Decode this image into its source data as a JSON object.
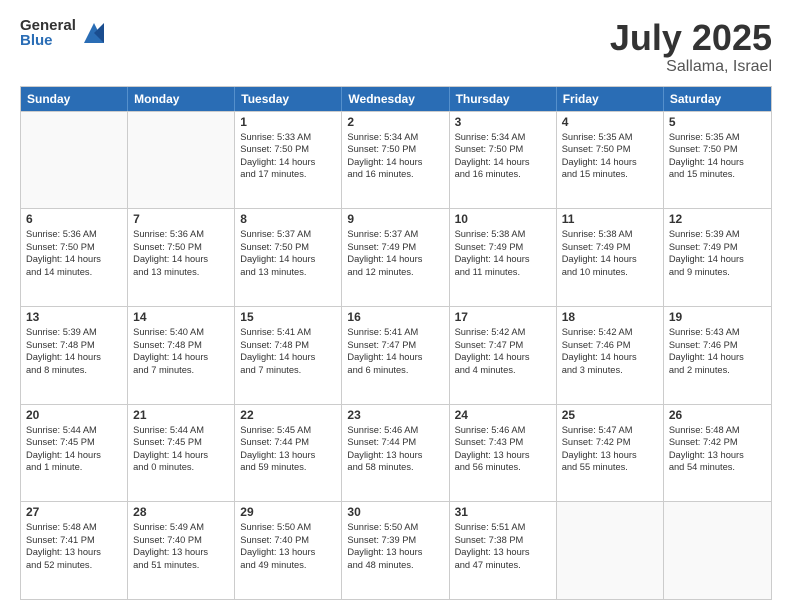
{
  "header": {
    "logo_general": "General",
    "logo_blue": "Blue",
    "title": "July 2025",
    "subtitle": "Sallama, Israel"
  },
  "days": [
    "Sunday",
    "Monday",
    "Tuesday",
    "Wednesday",
    "Thursday",
    "Friday",
    "Saturday"
  ],
  "rows": [
    [
      {
        "day": "",
        "lines": []
      },
      {
        "day": "",
        "lines": []
      },
      {
        "day": "1",
        "lines": [
          "Sunrise: 5:33 AM",
          "Sunset: 7:50 PM",
          "Daylight: 14 hours",
          "and 17 minutes."
        ]
      },
      {
        "day": "2",
        "lines": [
          "Sunrise: 5:34 AM",
          "Sunset: 7:50 PM",
          "Daylight: 14 hours",
          "and 16 minutes."
        ]
      },
      {
        "day": "3",
        "lines": [
          "Sunrise: 5:34 AM",
          "Sunset: 7:50 PM",
          "Daylight: 14 hours",
          "and 16 minutes."
        ]
      },
      {
        "day": "4",
        "lines": [
          "Sunrise: 5:35 AM",
          "Sunset: 7:50 PM",
          "Daylight: 14 hours",
          "and 15 minutes."
        ]
      },
      {
        "day": "5",
        "lines": [
          "Sunrise: 5:35 AM",
          "Sunset: 7:50 PM",
          "Daylight: 14 hours",
          "and 15 minutes."
        ]
      }
    ],
    [
      {
        "day": "6",
        "lines": [
          "Sunrise: 5:36 AM",
          "Sunset: 7:50 PM",
          "Daylight: 14 hours",
          "and 14 minutes."
        ]
      },
      {
        "day": "7",
        "lines": [
          "Sunrise: 5:36 AM",
          "Sunset: 7:50 PM",
          "Daylight: 14 hours",
          "and 13 minutes."
        ]
      },
      {
        "day": "8",
        "lines": [
          "Sunrise: 5:37 AM",
          "Sunset: 7:50 PM",
          "Daylight: 14 hours",
          "and 13 minutes."
        ]
      },
      {
        "day": "9",
        "lines": [
          "Sunrise: 5:37 AM",
          "Sunset: 7:49 PM",
          "Daylight: 14 hours",
          "and 12 minutes."
        ]
      },
      {
        "day": "10",
        "lines": [
          "Sunrise: 5:38 AM",
          "Sunset: 7:49 PM",
          "Daylight: 14 hours",
          "and 11 minutes."
        ]
      },
      {
        "day": "11",
        "lines": [
          "Sunrise: 5:38 AM",
          "Sunset: 7:49 PM",
          "Daylight: 14 hours",
          "and 10 minutes."
        ]
      },
      {
        "day": "12",
        "lines": [
          "Sunrise: 5:39 AM",
          "Sunset: 7:49 PM",
          "Daylight: 14 hours",
          "and 9 minutes."
        ]
      }
    ],
    [
      {
        "day": "13",
        "lines": [
          "Sunrise: 5:39 AM",
          "Sunset: 7:48 PM",
          "Daylight: 14 hours",
          "and 8 minutes."
        ]
      },
      {
        "day": "14",
        "lines": [
          "Sunrise: 5:40 AM",
          "Sunset: 7:48 PM",
          "Daylight: 14 hours",
          "and 7 minutes."
        ]
      },
      {
        "day": "15",
        "lines": [
          "Sunrise: 5:41 AM",
          "Sunset: 7:48 PM",
          "Daylight: 14 hours",
          "and 7 minutes."
        ]
      },
      {
        "day": "16",
        "lines": [
          "Sunrise: 5:41 AM",
          "Sunset: 7:47 PM",
          "Daylight: 14 hours",
          "and 6 minutes."
        ]
      },
      {
        "day": "17",
        "lines": [
          "Sunrise: 5:42 AM",
          "Sunset: 7:47 PM",
          "Daylight: 14 hours",
          "and 4 minutes."
        ]
      },
      {
        "day": "18",
        "lines": [
          "Sunrise: 5:42 AM",
          "Sunset: 7:46 PM",
          "Daylight: 14 hours",
          "and 3 minutes."
        ]
      },
      {
        "day": "19",
        "lines": [
          "Sunrise: 5:43 AM",
          "Sunset: 7:46 PM",
          "Daylight: 14 hours",
          "and 2 minutes."
        ]
      }
    ],
    [
      {
        "day": "20",
        "lines": [
          "Sunrise: 5:44 AM",
          "Sunset: 7:45 PM",
          "Daylight: 14 hours",
          "and 1 minute."
        ]
      },
      {
        "day": "21",
        "lines": [
          "Sunrise: 5:44 AM",
          "Sunset: 7:45 PM",
          "Daylight: 14 hours",
          "and 0 minutes."
        ]
      },
      {
        "day": "22",
        "lines": [
          "Sunrise: 5:45 AM",
          "Sunset: 7:44 PM",
          "Daylight: 13 hours",
          "and 59 minutes."
        ]
      },
      {
        "day": "23",
        "lines": [
          "Sunrise: 5:46 AM",
          "Sunset: 7:44 PM",
          "Daylight: 13 hours",
          "and 58 minutes."
        ]
      },
      {
        "day": "24",
        "lines": [
          "Sunrise: 5:46 AM",
          "Sunset: 7:43 PM",
          "Daylight: 13 hours",
          "and 56 minutes."
        ]
      },
      {
        "day": "25",
        "lines": [
          "Sunrise: 5:47 AM",
          "Sunset: 7:42 PM",
          "Daylight: 13 hours",
          "and 55 minutes."
        ]
      },
      {
        "day": "26",
        "lines": [
          "Sunrise: 5:48 AM",
          "Sunset: 7:42 PM",
          "Daylight: 13 hours",
          "and 54 minutes."
        ]
      }
    ],
    [
      {
        "day": "27",
        "lines": [
          "Sunrise: 5:48 AM",
          "Sunset: 7:41 PM",
          "Daylight: 13 hours",
          "and 52 minutes."
        ]
      },
      {
        "day": "28",
        "lines": [
          "Sunrise: 5:49 AM",
          "Sunset: 7:40 PM",
          "Daylight: 13 hours",
          "and 51 minutes."
        ]
      },
      {
        "day": "29",
        "lines": [
          "Sunrise: 5:50 AM",
          "Sunset: 7:40 PM",
          "Daylight: 13 hours",
          "and 49 minutes."
        ]
      },
      {
        "day": "30",
        "lines": [
          "Sunrise: 5:50 AM",
          "Sunset: 7:39 PM",
          "Daylight: 13 hours",
          "and 48 minutes."
        ]
      },
      {
        "day": "31",
        "lines": [
          "Sunrise: 5:51 AM",
          "Sunset: 7:38 PM",
          "Daylight: 13 hours",
          "and 47 minutes."
        ]
      },
      {
        "day": "",
        "lines": []
      },
      {
        "day": "",
        "lines": []
      }
    ]
  ]
}
